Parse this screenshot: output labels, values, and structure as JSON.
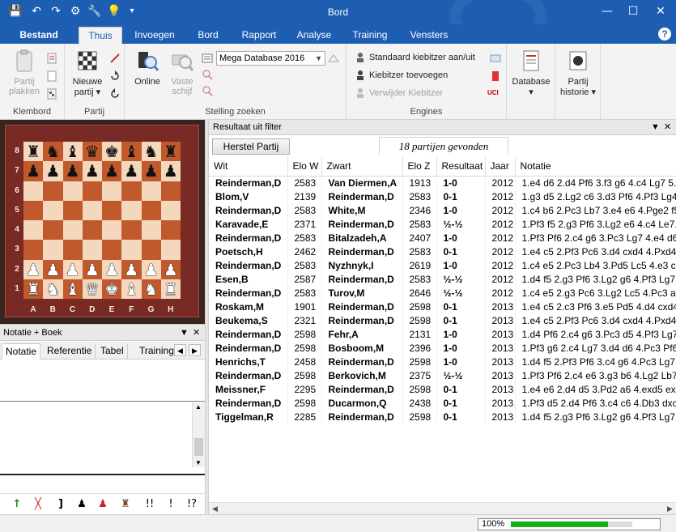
{
  "window": {
    "title": "Bord"
  },
  "ribbon_tabs": [
    {
      "label": "Bestand"
    },
    {
      "label": "Thuis"
    },
    {
      "label": "Invoegen"
    },
    {
      "label": "Bord"
    },
    {
      "label": "Rapport"
    },
    {
      "label": "Analyse"
    },
    {
      "label": "Training"
    },
    {
      "label": "Vensters"
    }
  ],
  "ribbon": {
    "klembord": {
      "paste_line1": "Partij",
      "paste_line2": "plakken",
      "group": "Klembord"
    },
    "partij": {
      "new_line1": "Nieuwe",
      "new_line2": "partij",
      "group": "Partij"
    },
    "stelling": {
      "online": "Online",
      "fixed_line1": "Vaste",
      "fixed_line2": "schijf",
      "database_select": "Mega Database 2016",
      "group": "Stelling zoeken"
    },
    "engines": {
      "item1": "Standaard kiebitzer aan/uit",
      "item2": "Kiebitzer toevoegen",
      "item3": "Verwijder Kiebitzer",
      "group": "Engines"
    },
    "database": {
      "label": "Database"
    },
    "history": {
      "line1": "Partij",
      "line2": "historie"
    }
  },
  "board": {
    "ranks": [
      "8",
      "7",
      "6",
      "5",
      "4",
      "3",
      "2",
      "1"
    ],
    "files": [
      "A",
      "B",
      "C",
      "D",
      "E",
      "F",
      "G",
      "H"
    ],
    "position": [
      [
        "r",
        "n",
        "b",
        "q",
        "k",
        "b",
        "n",
        "r"
      ],
      [
        "p",
        "p",
        "p",
        "p",
        "p",
        "p",
        "p",
        "p"
      ],
      [
        "",
        "",
        "",
        "",
        "",
        "",
        "",
        ""
      ],
      [
        "",
        "",
        "",
        "",
        "",
        "",
        "",
        ""
      ],
      [
        "",
        "",
        "",
        "",
        "",
        "",
        "",
        ""
      ],
      [
        "",
        "",
        "",
        "",
        "",
        "",
        "",
        ""
      ],
      [
        "P",
        "P",
        "P",
        "P",
        "P",
        "P",
        "P",
        "P"
      ],
      [
        "R",
        "N",
        "B",
        "Q",
        "K",
        "B",
        "N",
        "R"
      ]
    ]
  },
  "notation_pane": {
    "title": "Notatie + Boek",
    "tabs": [
      {
        "label": "Notatie"
      },
      {
        "label": "Referentie"
      },
      {
        "label": "Tabel"
      },
      {
        "label": "Training"
      }
    ],
    "toolbar": {
      "exclam_double": "!!",
      "exclam": "!",
      "question_exclam": "!?",
      "bracket": "]"
    }
  },
  "results": {
    "title": "Resultaat uit filter",
    "reset_button": "Herstel Partij",
    "found_label": "18 partijen gevonden",
    "columns": [
      "Wit",
      "Elo W",
      "Zwart",
      "Elo Z",
      "Resultaat",
      "Jaar",
      "Notatie"
    ],
    "rows": [
      [
        "Reinderman,D",
        "2583",
        "Van Diermen,A",
        "1913",
        "1-0",
        "2012",
        "1.e4 d6 2.d4 Pf6 3.f3 g6 4.c4 Lg7 5..."
      ],
      [
        "Blom,V",
        "2139",
        "Reinderman,D",
        "2583",
        "0-1",
        "2012",
        "1.g3 d5 2.Lg2 c6 3.d3 Pf6 4.Pf3 Lg4..."
      ],
      [
        "Reinderman,D",
        "2583",
        "White,M",
        "2346",
        "1-0",
        "2012",
        "1.c4 b6 2.Pc3 Lb7 3.e4 e6 4.Pge2 f5..."
      ],
      [
        "Karavade,E",
        "2371",
        "Reinderman,D",
        "2583",
        "½-½",
        "2012",
        "1.Pf3 f5 2.g3 Pf6 3.Lg2 e6 4.c4 Le7..."
      ],
      [
        "Reinderman,D",
        "2583",
        "Bitalzadeh,A",
        "2407",
        "1-0",
        "2012",
        "1.Pf3 Pf6 2.c4 g6 3.Pc3 Lg7 4.e4 d6..."
      ],
      [
        "Poetsch,H",
        "2462",
        "Reinderman,D",
        "2583",
        "0-1",
        "2012",
        "1.e4 c5 2.Pf3 Pc6 3.d4 cxd4 4.Pxd4..."
      ],
      [
        "Reinderman,D",
        "2583",
        "Nyzhnyk,I",
        "2619",
        "1-0",
        "2012",
        "1.c4 e5 2.Pc3 Lb4 3.Pd5 Lc5 4.e3 c6..."
      ],
      [
        "Esen,B",
        "2587",
        "Reinderman,D",
        "2583",
        "½-½",
        "2012",
        "1.d4 f5 2.g3 Pf6 3.Lg2 g6 4.Pf3 Lg7..."
      ],
      [
        "Reinderman,D",
        "2583",
        "Turov,M",
        "2646",
        "½-½",
        "2012",
        "1.c4 e5 2.g3 Pc6 3.Lg2 Lc5 4.Pc3 a6..."
      ],
      [
        "Roskam,M",
        "1901",
        "Reinderman,D",
        "2598",
        "0-1",
        "2013",
        "1.e4 c5 2.c3 Pf6 3.e5 Pd5 4.d4 cxd4..."
      ],
      [
        "Beukema,S",
        "2321",
        "Reinderman,D",
        "2598",
        "0-1",
        "2013",
        "1.e4 c5 2.Pf3 Pc6 3.d4 cxd4 4.Pxd4..."
      ],
      [
        "Reinderman,D",
        "2598",
        "Fehr,A",
        "2131",
        "1-0",
        "2013",
        "1.d4 Pf6 2.c4 g6 3.Pc3 d5 4.Pf3 Lg7..."
      ],
      [
        "Reinderman,D",
        "2598",
        "Bosboom,M",
        "2396",
        "1-0",
        "2013",
        "1.Pf3 g6 2.c4 Lg7 3.d4 d6 4.Pc3 Pf6..."
      ],
      [
        "Henrichs,T",
        "2458",
        "Reinderman,D",
        "2598",
        "1-0",
        "2013",
        "1.d4 f5 2.Pf3 Pf6 3.c4 g6 4.Pc3 Lg7..."
      ],
      [
        "Reinderman,D",
        "2598",
        "Berkovich,M",
        "2375",
        "½-½",
        "2013",
        "1.Pf3 Pf6 2.c4 e6 3.g3 b6 4.Lg2 Lb7..."
      ],
      [
        "Meissner,F",
        "2295",
        "Reinderman,D",
        "2598",
        "0-1",
        "2013",
        "1.e4 e6 2.d4 d5 3.Pd2 a6 4.exd5 ex..."
      ],
      [
        "Reinderman,D",
        "2598",
        "Ducarmon,Q",
        "2438",
        "0-1",
        "2013",
        "1.Pf3 d5 2.d4 Pf6 3.c4 c6 4.Db3 dxc..."
      ],
      [
        "Tiggelman,R",
        "2285",
        "Reinderman,D",
        "2598",
        "0-1",
        "2013",
        "1.d4 f5 2.g3 Pf6 3.Lg2 g6 4.Pf3 Lg7..."
      ]
    ]
  },
  "status": {
    "zoom_label": "100%",
    "progress": 0.8
  },
  "icons": {
    "save": "save-icon",
    "undo": "undo-icon",
    "redo": "redo-icon",
    "settings": "gear-icon",
    "wrench": "wrench-icon",
    "bulb": "lightbulb-icon",
    "qat_more": "chevron-down-icon"
  },
  "colors": {
    "accent": "#1d5eb3",
    "light_square": "#f4d8bd",
    "dark_square": "#c05a2c",
    "board_frame": "#7a2a24",
    "progress": "#18b018"
  }
}
